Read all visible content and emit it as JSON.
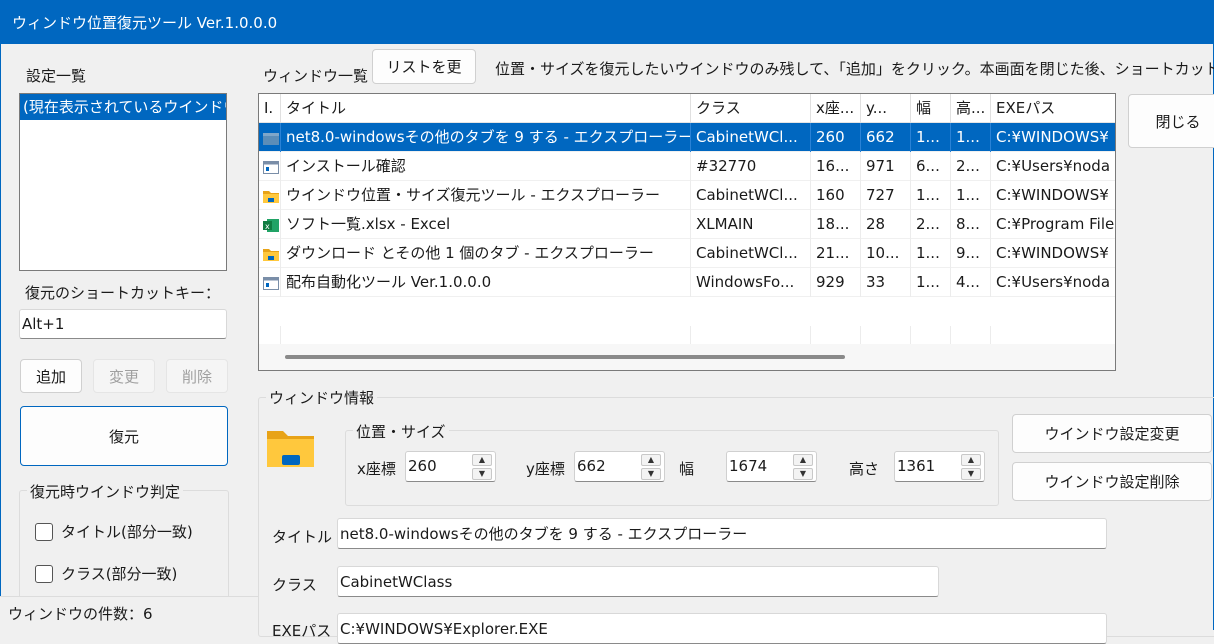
{
  "window": {
    "title": "ウィンドウ位置復元ツール Ver.1.0.0.0"
  },
  "settings": {
    "label": "設定一覧",
    "items": [
      "(現在表示されているウインドウ"
    ],
    "shortcut_label": "復元のショートカットキー：",
    "shortcut_value": "Alt+1",
    "add_label": "追加",
    "change_label": "変更",
    "delete_label": "削除",
    "restore_label": "復元",
    "judge_group_title": "復元時ウインドウ判定",
    "check_title_label": "タイトル(部分一致)",
    "check_class_label": "クラス(部分一致)"
  },
  "status": {
    "count_text": "ウィンドウの件数：6"
  },
  "window_list": {
    "label": "ウィンドウ一覧",
    "refresh_label": "リストを更",
    "hint": "位置・サイズを復元したいウインドウのみ残して、「追加」をクリック。本画面を閉じた後、ショートカットキー",
    "close_label": "閉じる",
    "columns": [
      "I.",
      "タイトル",
      "クラス",
      "x座...",
      "y...",
      "幅",
      "高...",
      "EXEパス"
    ],
    "rows": [
      [
        "",
        "net8.0-windowsその他のタブを 9 する - エクスプローラー",
        "CabinetWCl...",
        "260",
        "662",
        "1...",
        "1...",
        "C:¥WINDOWS¥"
      ],
      [
        "",
        "インストール確認",
        "#32770",
        "16...",
        "971",
        "6...",
        "2...",
        "C:¥Users¥noda"
      ],
      [
        "",
        "ウインドウ位置・サイズ復元ツール - エクスプローラー",
        "CabinetWCl...",
        "160",
        "727",
        "1...",
        "1...",
        "C:¥WINDOWS¥"
      ],
      [
        "",
        "ソフト一覧.xlsx - Excel",
        "XLMAIN",
        "18...",
        "28",
        "2...",
        "8...",
        "C:¥Program File"
      ],
      [
        "",
        "ダウンロード とその他 1 個のタブ - エクスプローラー",
        "CabinetWCl...",
        "21...",
        "10...",
        "1...",
        "9...",
        "C:¥WINDOWS¥"
      ],
      [
        "",
        "配布自動化ツール Ver.1.0.0.0",
        "WindowsFo...",
        "929",
        "33",
        "1...",
        "4...",
        "C:¥Users¥noda"
      ]
    ],
    "row_icons": [
      "explorer-folder-icon",
      "app-window-icon",
      "folder-icon",
      "excel-icon",
      "folder-icon",
      "app-window-icon"
    ],
    "selected_row": 0
  },
  "info": {
    "group_title": "ウィンドウ情報",
    "pos_group_title": "位置・サイズ",
    "x_label": "x座標",
    "x_value": "260",
    "y_label": "y座標",
    "y_value": "662",
    "w_label": "幅",
    "w_value": "1674",
    "h_label": "高さ",
    "h_value": "1361",
    "change_settings_label": "ウインドウ設定変更",
    "delete_settings_label": "ウインドウ設定削除",
    "title_label": "タイトル",
    "title_value": "net8.0-windowsその他のタブを 9 する - エクスプローラー",
    "class_label": "クラス",
    "class_value": "CabinetWClass",
    "exe_label": "EXEパス",
    "exe_value": "C:¥WINDOWS¥Explorer.EXE"
  },
  "colors": {
    "titlebar": "#0067c0",
    "selection": "#0067c0"
  }
}
